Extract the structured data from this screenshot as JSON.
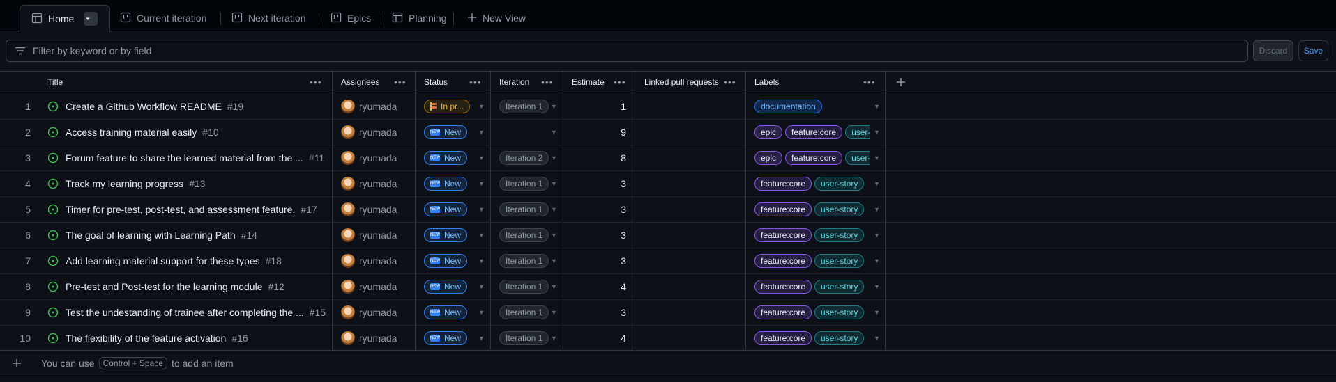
{
  "tabs": [
    {
      "label": "Home",
      "icon": "table-icon",
      "active": true
    },
    {
      "label": "Current iteration",
      "icon": "board-icon"
    },
    {
      "label": "Next iteration",
      "icon": "board-icon"
    },
    {
      "label": "Epics",
      "icon": "board-icon"
    },
    {
      "label": "Planning",
      "icon": "table-icon"
    }
  ],
  "new_view_label": "New View",
  "filter": {
    "placeholder": "Filter by keyword or by field"
  },
  "actions": {
    "discard": "Discard",
    "save": "Save"
  },
  "columns": [
    "Title",
    "Assignees",
    "Status",
    "Iteration",
    "Estimate",
    "Linked pull requests",
    "Labels"
  ],
  "rows": [
    {
      "n": "1",
      "title": "Create a Github Workflow README",
      "num": "#19",
      "assignee": "ryumada",
      "status": "In pr...",
      "status_kind": "progress",
      "iteration": "Iteration 1",
      "estimate": "1",
      "labels": [
        {
          "text": "documentation",
          "kind": "doc"
        }
      ]
    },
    {
      "n": "2",
      "title": "Access training material easily",
      "num": "#10",
      "assignee": "ryumada",
      "status": "New",
      "status_kind": "new",
      "iteration": "",
      "estimate": "9",
      "labels": [
        {
          "text": "epic",
          "kind": "epic"
        },
        {
          "text": "feature:core",
          "kind": "feat"
        },
        {
          "text": "user-s",
          "kind": "story"
        }
      ]
    },
    {
      "n": "3",
      "title": "Forum feature to share the learned material from the ...",
      "num": "#11",
      "assignee": "ryumada",
      "status": "New",
      "status_kind": "new",
      "iteration": "Iteration 2",
      "estimate": "8",
      "labels": [
        {
          "text": "epic",
          "kind": "epic"
        },
        {
          "text": "feature:core",
          "kind": "feat"
        },
        {
          "text": "user-s",
          "kind": "story"
        }
      ]
    },
    {
      "n": "4",
      "title": "Track my learning progress",
      "num": "#13",
      "assignee": "ryumada",
      "status": "New",
      "status_kind": "new",
      "iteration": "Iteration 1",
      "estimate": "3",
      "labels": [
        {
          "text": "feature:core",
          "kind": "feat"
        },
        {
          "text": "user-story",
          "kind": "story"
        }
      ]
    },
    {
      "n": "5",
      "title": "Timer for pre-test, post-test, and assessment feature.",
      "num": "#17",
      "assignee": "ryumada",
      "status": "New",
      "status_kind": "new",
      "iteration": "Iteration 1",
      "estimate": "3",
      "labels": [
        {
          "text": "feature:core",
          "kind": "feat"
        },
        {
          "text": "user-story",
          "kind": "story"
        }
      ]
    },
    {
      "n": "6",
      "title": "The goal of learning with Learning Path",
      "num": "#14",
      "assignee": "ryumada",
      "status": "New",
      "status_kind": "new",
      "iteration": "Iteration 1",
      "estimate": "3",
      "labels": [
        {
          "text": "feature:core",
          "kind": "feat"
        },
        {
          "text": "user-story",
          "kind": "story"
        }
      ]
    },
    {
      "n": "7",
      "title": "Add learning material support for these types",
      "num": "#18",
      "assignee": "ryumada",
      "status": "New",
      "status_kind": "new",
      "iteration": "Iteration 1",
      "estimate": "3",
      "labels": [
        {
          "text": "feature:core",
          "kind": "feat"
        },
        {
          "text": "user-story",
          "kind": "story"
        }
      ]
    },
    {
      "n": "8",
      "title": "Pre-test and Post-test for the learning module",
      "num": "#12",
      "assignee": "ryumada",
      "status": "New",
      "status_kind": "new",
      "iteration": "Iteration 1",
      "estimate": "4",
      "labels": [
        {
          "text": "feature:core",
          "kind": "feat"
        },
        {
          "text": "user-story",
          "kind": "story"
        }
      ]
    },
    {
      "n": "9",
      "title": "Test the undestanding of trainee after completing the ...",
      "num": "#15",
      "assignee": "ryumada",
      "status": "New",
      "status_kind": "new",
      "iteration": "Iteration 1",
      "estimate": "3",
      "labels": [
        {
          "text": "feature:core",
          "kind": "feat"
        },
        {
          "text": "user-story",
          "kind": "story"
        }
      ]
    },
    {
      "n": "10",
      "title": "The flexibility of the feature activation",
      "num": "#16",
      "assignee": "ryumada",
      "status": "New",
      "status_kind": "new",
      "iteration": "Iteration 1",
      "estimate": "4",
      "labels": [
        {
          "text": "feature:core",
          "kind": "feat"
        },
        {
          "text": "user-story",
          "kind": "story"
        }
      ]
    }
  ],
  "footer": {
    "prefix": "You can use",
    "shortcut": "Control + Space",
    "suffix": "to add an item"
  }
}
